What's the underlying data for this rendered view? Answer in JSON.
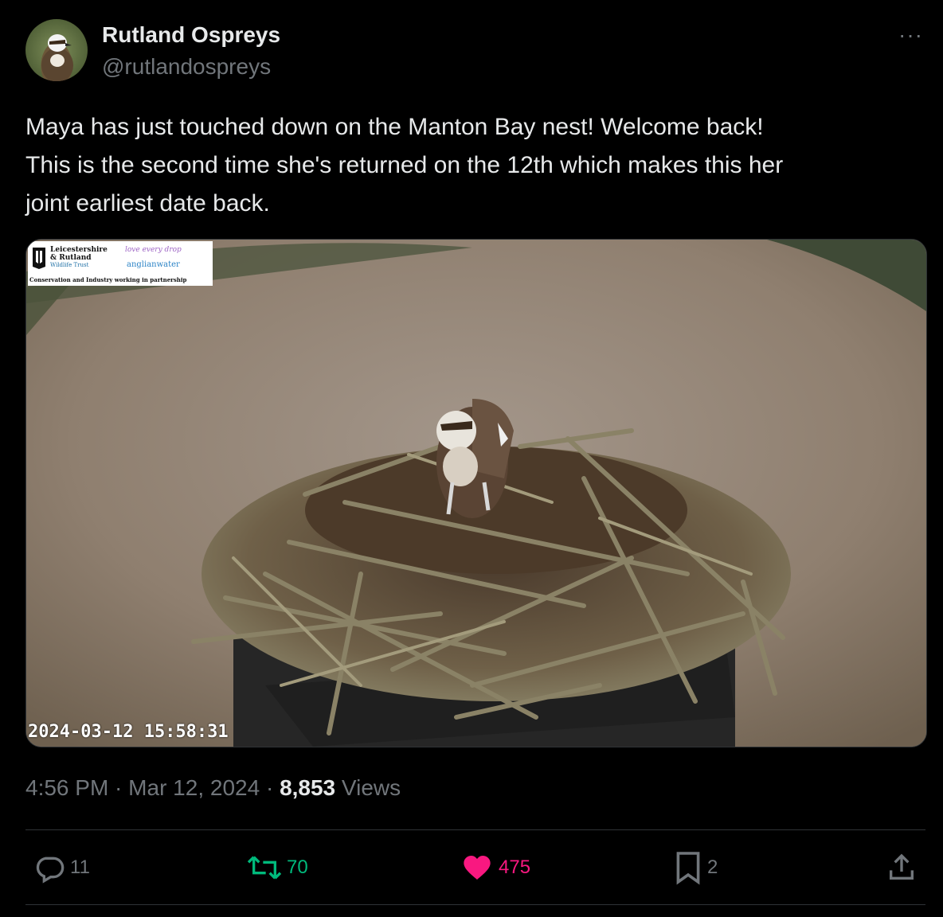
{
  "author": {
    "name": "Rutland Ospreys",
    "handle": "@rutlandospreys"
  },
  "more_label": "···",
  "tweet_text": [
    "Maya has just touched down on the Manton Bay nest! Welcome back!",
    "This is the second time she's returned on the 12th which makes this her",
    "joint earliest date back."
  ],
  "media": {
    "logo": {
      "line1": "Leicestershire",
      "line2": "& Rutland",
      "line3": "Wildlife Trust",
      "partner1": "love every drop",
      "partner2": "anglianwater",
      "line4": "Conservation and Industry working in partnership"
    },
    "timestamp": "2024-03-12  15:58:31"
  },
  "meta": {
    "time": "4:56 PM",
    "sep": " · ",
    "date": "Mar 12, 2024",
    "views_count": "8,853",
    "views_label": "Views"
  },
  "actions": {
    "replies": "11",
    "reposts": "70",
    "likes": "475",
    "bookmarks": "2"
  },
  "colors": {
    "repost": "#00ba7c",
    "like": "#f91880",
    "muted": "#71767b"
  }
}
